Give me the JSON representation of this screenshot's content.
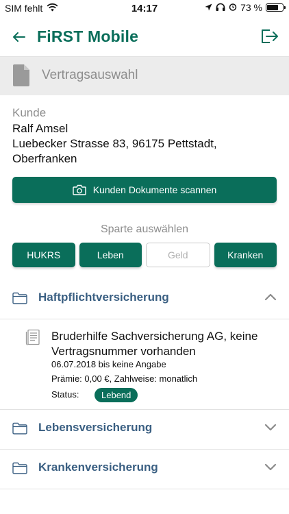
{
  "status_bar": {
    "carrier": "SIM fehlt",
    "time": "14:17",
    "battery_percent": "73 %",
    "battery_level": 0.73
  },
  "header": {
    "title": "FiRST Mobile",
    "back_icon": "arrow-left-icon",
    "logout_icon": "logout-icon"
  },
  "section": {
    "title": "Vertragsauswahl",
    "icon": "document-icon"
  },
  "customer": {
    "label": "Kunde",
    "name": "Ralf Amsel",
    "address_line1": "Luebecker Strasse 83, 96175 Pettstadt,",
    "address_line2": "Oberfranken"
  },
  "scan_button": {
    "label": "Kunden Dokumente scannen",
    "icon": "camera-icon"
  },
  "sparte": {
    "label": "Sparte auswählen",
    "options": [
      {
        "label": "HUKRS",
        "active": true
      },
      {
        "label": "Leben",
        "active": true
      },
      {
        "label": "Geld",
        "active": false
      },
      {
        "label": "Kranken",
        "active": true
      }
    ]
  },
  "groups": [
    {
      "title": "Haftpflichtversicherung",
      "expanded": true
    },
    {
      "title": "Lebensversicherung",
      "expanded": false
    },
    {
      "title": "Krankenversicherung",
      "expanded": false
    }
  ],
  "contract": {
    "name": "Bruderhilfe Sachversicherung AG, keine Vertragsnummer vorhanden",
    "period": "06.07.2018 bis keine Angabe",
    "premium": "Prämie: 0,00 €, Zahlweise: monatlich",
    "status_label": "Status:",
    "status_value": "Lebend"
  },
  "colors": {
    "brand": "#0a6e5a",
    "group_title": "#3a5f82",
    "muted": "#8e8e8e"
  }
}
